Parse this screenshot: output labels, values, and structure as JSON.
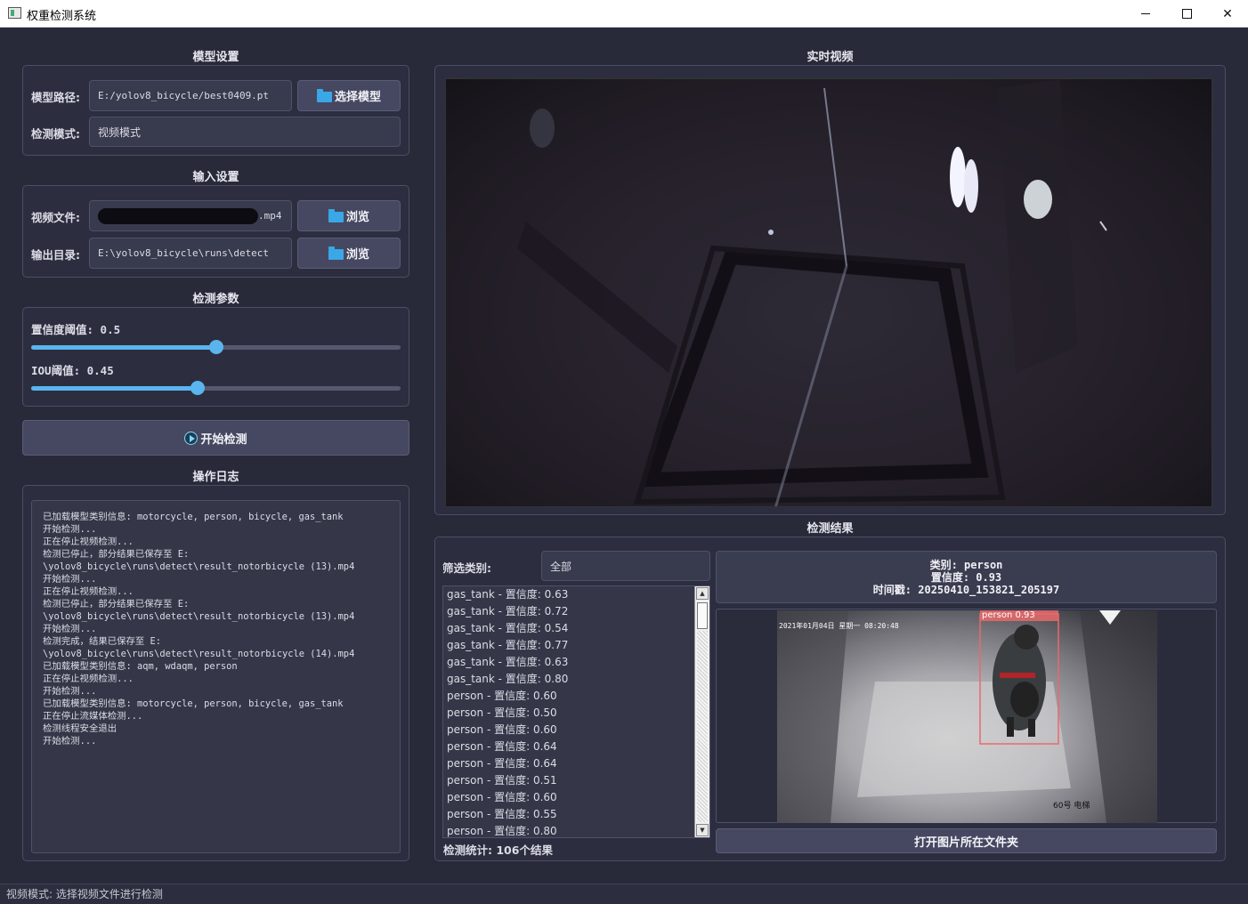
{
  "window": {
    "title": "权重检测系统"
  },
  "model": {
    "section_title": "模型设置",
    "path_label": "模型路径:",
    "path_value": "E:/yolov8_bicycle/best0409.pt",
    "select_button": "选择模型",
    "mode_label": "检测模式:",
    "mode_value": "视频模式"
  },
  "input": {
    "section_title": "输入设置",
    "video_label": "视频文件:",
    "video_value_suffix": ".mp4",
    "browse_video": "浏览",
    "output_label": "输出目录:",
    "output_value": "E:\\yolov8_bicycle\\runs\\detect",
    "browse_output": "浏览"
  },
  "params": {
    "section_title": "检测参数",
    "conf_label": "置信度阈值: 0.5",
    "conf_value": 0.5,
    "iou_label": "IOU阈值: 0.45",
    "iou_value": 0.45
  },
  "start_button": "开始检测",
  "log": {
    "section_title": "操作日志",
    "lines": [
      "已加载模型类别信息: motorcycle, person, bicycle, gas_tank",
      "开始检测...",
      "正在停止视频检测...",
      "检测已停止，部分结果已保存至 E:",
      "\\yolov8_bicycle\\runs\\detect\\result_notorbicycle (13).mp4",
      "开始检测...",
      "正在停止视频检测...",
      "检测已停止，部分结果已保存至 E:",
      "\\yolov8_bicycle\\runs\\detect\\result_notorbicycle (13).mp4",
      "开始检测...",
      "检测完成，结果已保存至 E:",
      "\\yolov8_bicycle\\runs\\detect\\result_notorbicycle (14).mp4",
      "已加载模型类别信息: aqm, wdaqm, person",
      "正在停止视频检测...",
      "开始检测...",
      "已加载模型类别信息: motorcycle, person, bicycle, gas_tank",
      "正在停止流媒体检测...",
      "检测线程安全退出",
      "开始检测..."
    ]
  },
  "video": {
    "section_title": "实时视频"
  },
  "results": {
    "section_title": "检测结果",
    "filter_label": "筛选类别:",
    "filter_value": "全部",
    "items": [
      "gas_tank - 置信度: 0.63",
      "gas_tank - 置信度: 0.72",
      "gas_tank - 置信度: 0.54",
      "gas_tank - 置信度: 0.77",
      "gas_tank - 置信度: 0.63",
      "gas_tank - 置信度: 0.80",
      "person - 置信度: 0.60",
      "person - 置信度: 0.50",
      "person - 置信度: 0.60",
      "person - 置信度: 0.64",
      "person - 置信度: 0.64",
      "person - 置信度: 0.51",
      "person - 置信度: 0.60",
      "person - 置信度: 0.55",
      "person - 置信度: 0.80"
    ],
    "stats": "检测统计: 106个结果",
    "detail": {
      "class_line": "类别: person",
      "conf_line": "置信度: 0.93",
      "time_line": "时间戳: 20250410_153821_205197"
    },
    "thumb_box_label": "person 0.93",
    "thumb_timestamp": "2021年01月04日 星期一 08:20:48",
    "thumb_caption": "60号 电梯",
    "open_folder_button": "打开图片所在文件夹"
  },
  "status": "视频模式: 选择视频文件进行检测"
}
